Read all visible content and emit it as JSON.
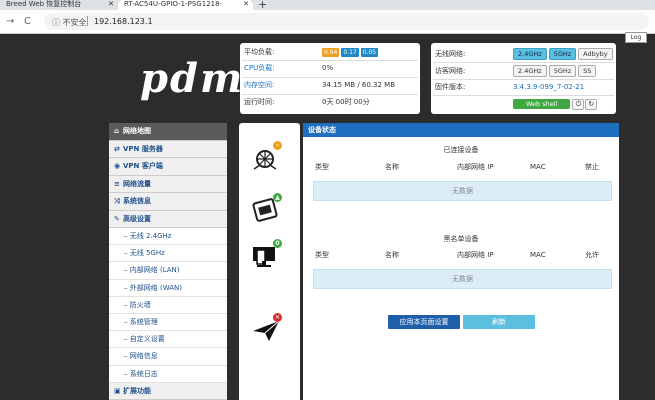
{
  "browser": {
    "tabs": [
      {
        "title": "Breed Web 恢复控制台"
      },
      {
        "title": "RT-AC54U-GPIO-1-PSG1218-"
      }
    ],
    "insecure_label": "不安全",
    "url": "192.168.123.1"
  },
  "log_button": "Log",
  "logo_text": "pdm",
  "status": {
    "load_label": "平均负载:",
    "load_values": [
      "0.64",
      "0.17",
      "0.05"
    ],
    "load_colors": [
      "#f0a020",
      "#1e88c8",
      "#1e88c8"
    ],
    "cpu_label": "CPU负载:",
    "cpu_value": "0%",
    "mem_label": "内存空间:",
    "mem_value": "34.15 MB / 60.32 MB",
    "uptime_label": "运行时间:",
    "uptime_value": "0天 00时 00分"
  },
  "wireless": {
    "wifi_label": "无线网络:",
    "wifi_buttons": [
      "2.4GHz",
      "5GHz",
      "Adbyby"
    ],
    "guest_label": "访客网络:",
    "guest_buttons": [
      "2.4GHz",
      "5GHz",
      "SS"
    ],
    "fw_label": "固件版本:",
    "fw_value": "3.4.3.9-099_7-02-21",
    "webshell_label": "Web shell",
    "accent": "#5bbfe0"
  },
  "sidebar": {
    "groups": [
      {
        "icon": "home-icon",
        "glyph": "⌂",
        "label": "网络地图"
      },
      {
        "icon": "vpn-server-icon",
        "glyph": "⇄",
        "label": "VPN 服务器"
      },
      {
        "icon": "globe-icon",
        "glyph": "◉",
        "label": "VPN 客户端"
      },
      {
        "icon": "list-icon",
        "glyph": "≡",
        "label": "网络流量"
      },
      {
        "icon": "shuffle-icon",
        "glyph": "⤨",
        "label": "系统信息"
      },
      {
        "icon": "wrench-icon",
        "glyph": "✎",
        "label": "高级设置"
      }
    ],
    "items": [
      "无线 2.4GHz",
      "无线 5GHz",
      "内部网络 (LAN)",
      "外部网络 (WAN)",
      "防火墙",
      "系统管理",
      "自定义设置",
      "网络信息",
      "系统日志"
    ],
    "last_group": {
      "icon": "extension-icon",
      "glyph": "▣",
      "label": "扩展功能"
    }
  },
  "main": {
    "header": "设备状态",
    "connected_title": "已连接设备",
    "connected_cols": [
      "类型",
      "名称",
      "内部网络 IP",
      "MAC",
      "禁止"
    ],
    "blacklist_title": "黑名单设备",
    "blacklist_cols": [
      "类型",
      "名称",
      "内部网络 IP",
      "MAC",
      "允许"
    ],
    "no_data": "无数据",
    "apply_button": "应用本页面设置",
    "refresh_button": "刷新"
  }
}
